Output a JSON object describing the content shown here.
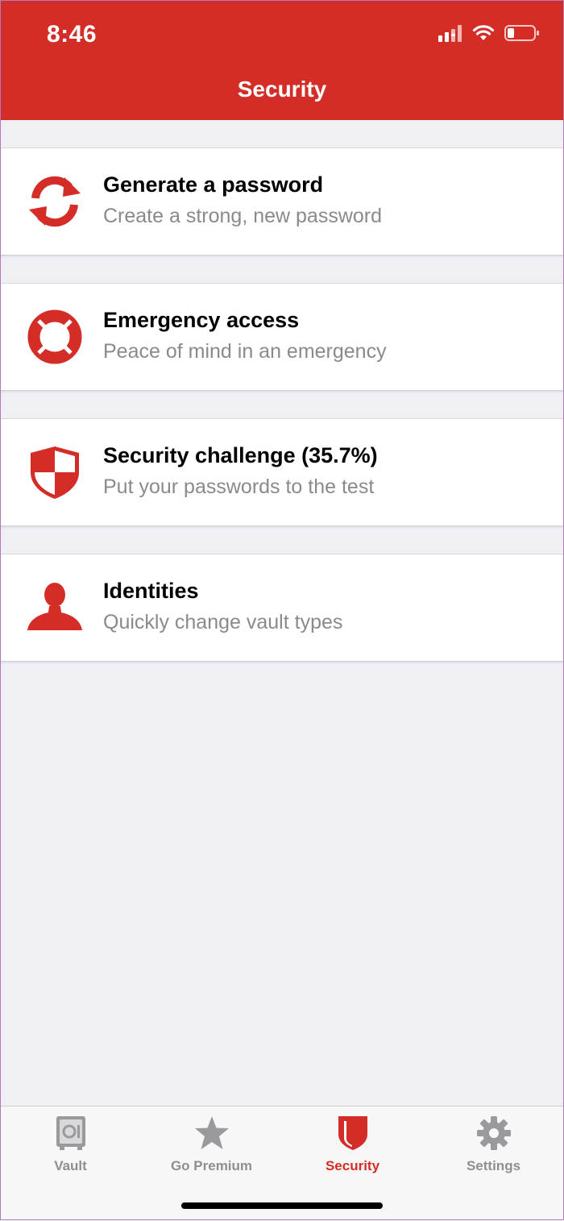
{
  "status_bar": {
    "time": "8:46"
  },
  "header": {
    "title": "Security"
  },
  "colors": {
    "brand": "#d42d27",
    "tab_inactive": "#8e8e93"
  },
  "items": [
    {
      "title": "Generate a password",
      "subtitle": "Create a strong, new password",
      "icon": "refresh-icon"
    },
    {
      "title": "Emergency access",
      "subtitle": "Peace of mind in an emergency",
      "icon": "lifebuoy-icon"
    },
    {
      "title": "Security challenge (35.7%)",
      "subtitle": "Put your passwords to the test",
      "icon": "shield-icon"
    },
    {
      "title": "Identities",
      "subtitle": "Quickly change vault types",
      "icon": "person-icon"
    }
  ],
  "tabbar": {
    "tabs": [
      {
        "label": "Vault",
        "icon": "vault-icon",
        "active": false
      },
      {
        "label": "Go Premium",
        "icon": "star-icon",
        "active": false
      },
      {
        "label": "Security",
        "icon": "shield-icon",
        "active": true
      },
      {
        "label": "Settings",
        "icon": "gear-icon",
        "active": false
      }
    ]
  }
}
